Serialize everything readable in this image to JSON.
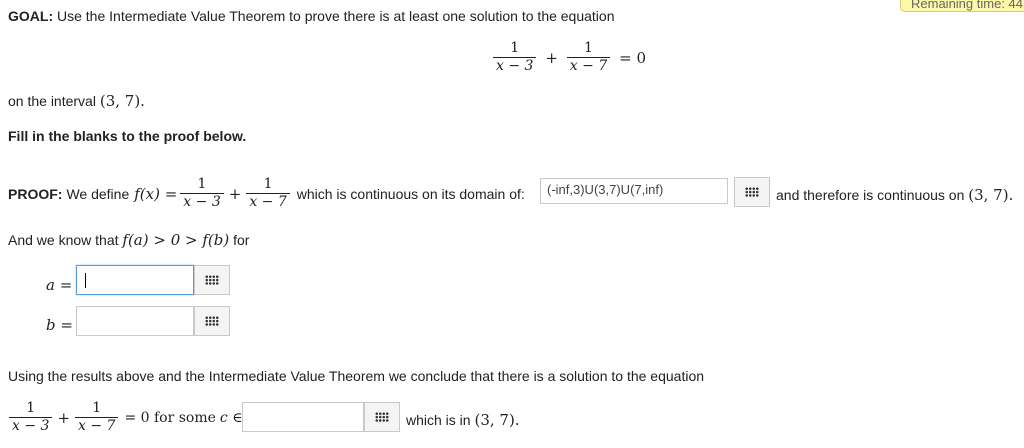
{
  "timer": {
    "text": "Remaining time: 44"
  },
  "goal": {
    "label": "GOAL:",
    "text": "Use the Intermediate Value Theorem to prove there is at least one solution to the equation",
    "frac1_num": "1",
    "frac1_den": "x − 3",
    "plus": "+",
    "frac2_num": "1",
    "frac2_den": "x − 7",
    "equals_zero": "= 0",
    "interval_prefix": "on the interval",
    "interval": "(3, 7).",
    "instruction": "Fill in the blanks to the proof below."
  },
  "proof": {
    "label": "PROOF:",
    "define_text": "We define",
    "fx": "f(x) =",
    "frac1_num": "1",
    "frac1_den": "x − 3",
    "plus": "+",
    "frac2_num": "1",
    "frac2_den": "x − 7",
    "continuous_text": "which is continuous on its domain of:",
    "domain_value": "(-inf,3)U(3,7)U(7,inf)",
    "therefore_text": "and therefore is continuous on",
    "interval": "(3, 7)."
  },
  "know": {
    "text_prefix": "And we know that",
    "inequality": "f(a) > 0 > f(b)",
    "text_suffix": "for",
    "a_label": "a =",
    "a_value": "",
    "b_label": "b =",
    "b_value": ""
  },
  "conclusion": {
    "text": "Using the results above and the Intermediate Value Theorem we conclude that there is a solution to the equation",
    "frac1_num": "1",
    "frac1_den": "x − 3",
    "plus": "+",
    "frac2_num": "1",
    "frac2_den": "x − 7",
    "equals_text": "= 0 for some",
    "c_in": "c ∈",
    "c_value": "",
    "which_text": "which is in",
    "interval": "(3, 7)."
  },
  "icons": {
    "keyboard": "grid-keypad-icon"
  }
}
